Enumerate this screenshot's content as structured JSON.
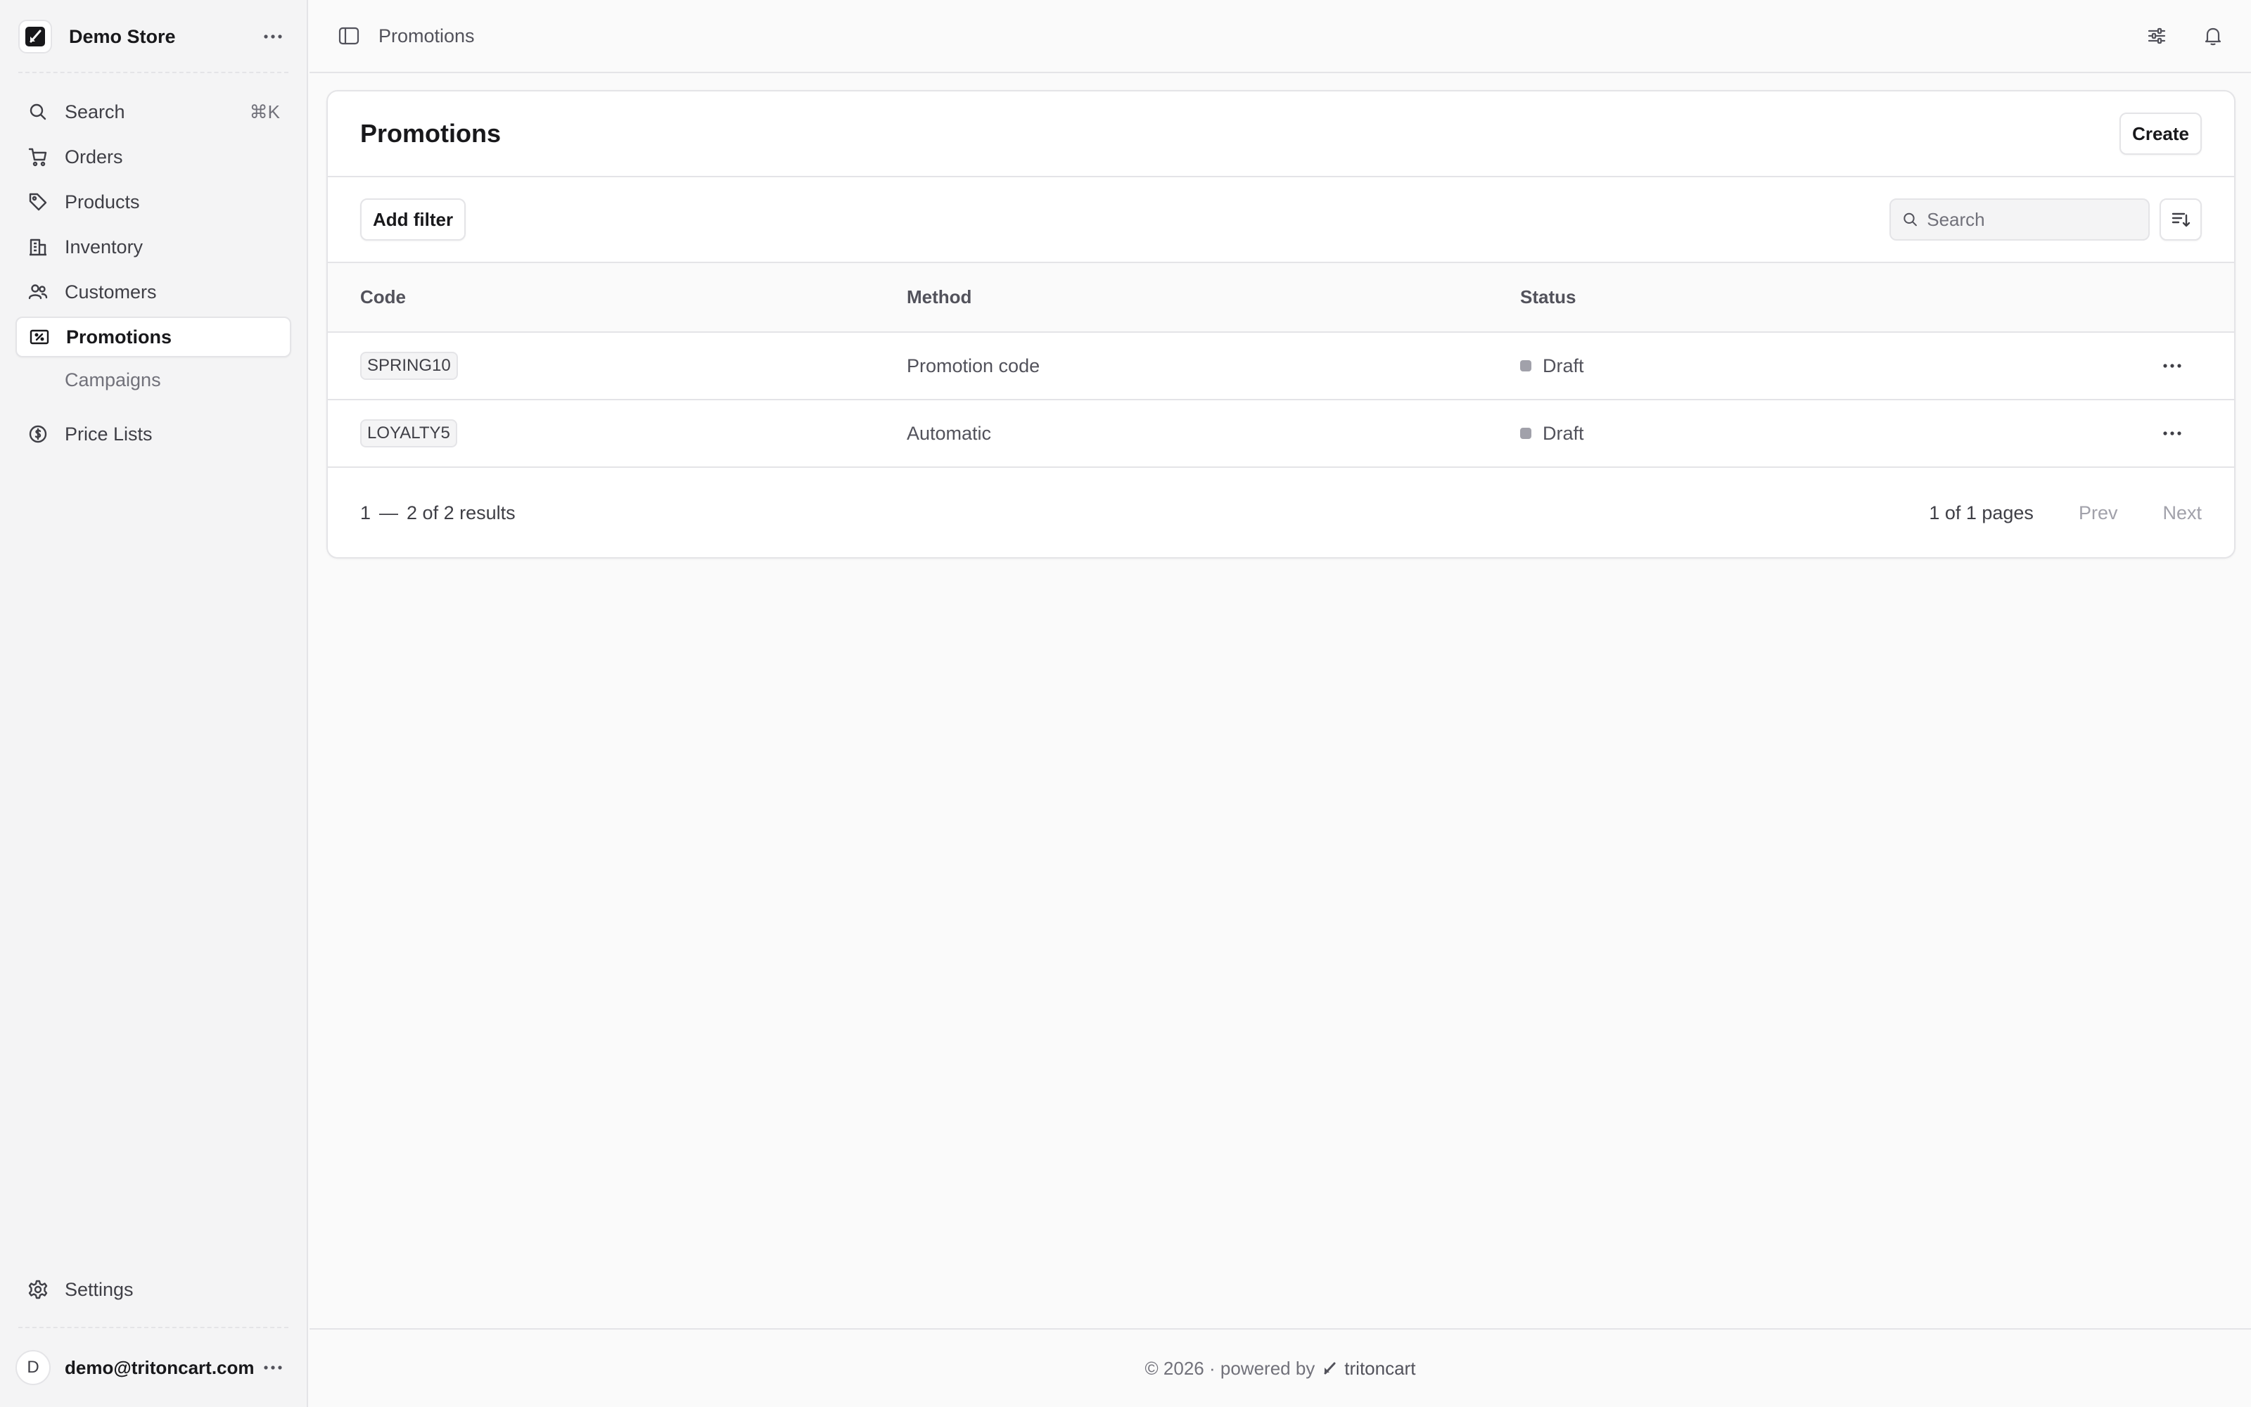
{
  "sidebar": {
    "store_name": "Demo Store",
    "store_logo_icon": "slash-logo-icon",
    "nav": [
      {
        "label": "Search",
        "icon": "search-icon",
        "shortcut": "⌘K"
      },
      {
        "label": "Orders",
        "icon": "cart-icon"
      },
      {
        "label": "Products",
        "icon": "tag-icon"
      },
      {
        "label": "Inventory",
        "icon": "building-icon"
      },
      {
        "label": "Customers",
        "icon": "users-icon"
      },
      {
        "label": "Promotions",
        "icon": "receipt-percent-icon",
        "active": true
      },
      {
        "label": "Campaigns"
      },
      {
        "label": "Price Lists",
        "icon": "currency-dollar-icon"
      }
    ],
    "settings_label": "Settings",
    "user": {
      "initial": "D",
      "email": "demo@tritoncart.com"
    }
  },
  "topbar": {
    "breadcrumb": "Promotions"
  },
  "page": {
    "title": "Promotions",
    "create_label": "Create",
    "add_filter_label": "Add filter",
    "search_placeholder": "Search"
  },
  "table": {
    "headers": {
      "code": "Code",
      "method": "Method",
      "status": "Status"
    },
    "rows": [
      {
        "code": "SPRING10",
        "method": "Promotion code",
        "status": "Draft"
      },
      {
        "code": "LOYALTY5",
        "method": "Automatic",
        "status": "Draft"
      }
    ]
  },
  "pagination": {
    "range_start": "1",
    "dash": "—",
    "range_text": "2 of 2 results",
    "pages_text": "1 of 1 pages",
    "prev_label": "Prev",
    "next_label": "Next"
  },
  "footer": {
    "copyright": "© 2026 · powered by",
    "brand": "tritoncart"
  },
  "colors": {
    "sidebar_bg": "#f4f4f5",
    "page_bg": "#fafafa",
    "border": "#e4e4e7",
    "status_draft": "#a1a1aa",
    "disabled_text": "#a1a1aa"
  }
}
